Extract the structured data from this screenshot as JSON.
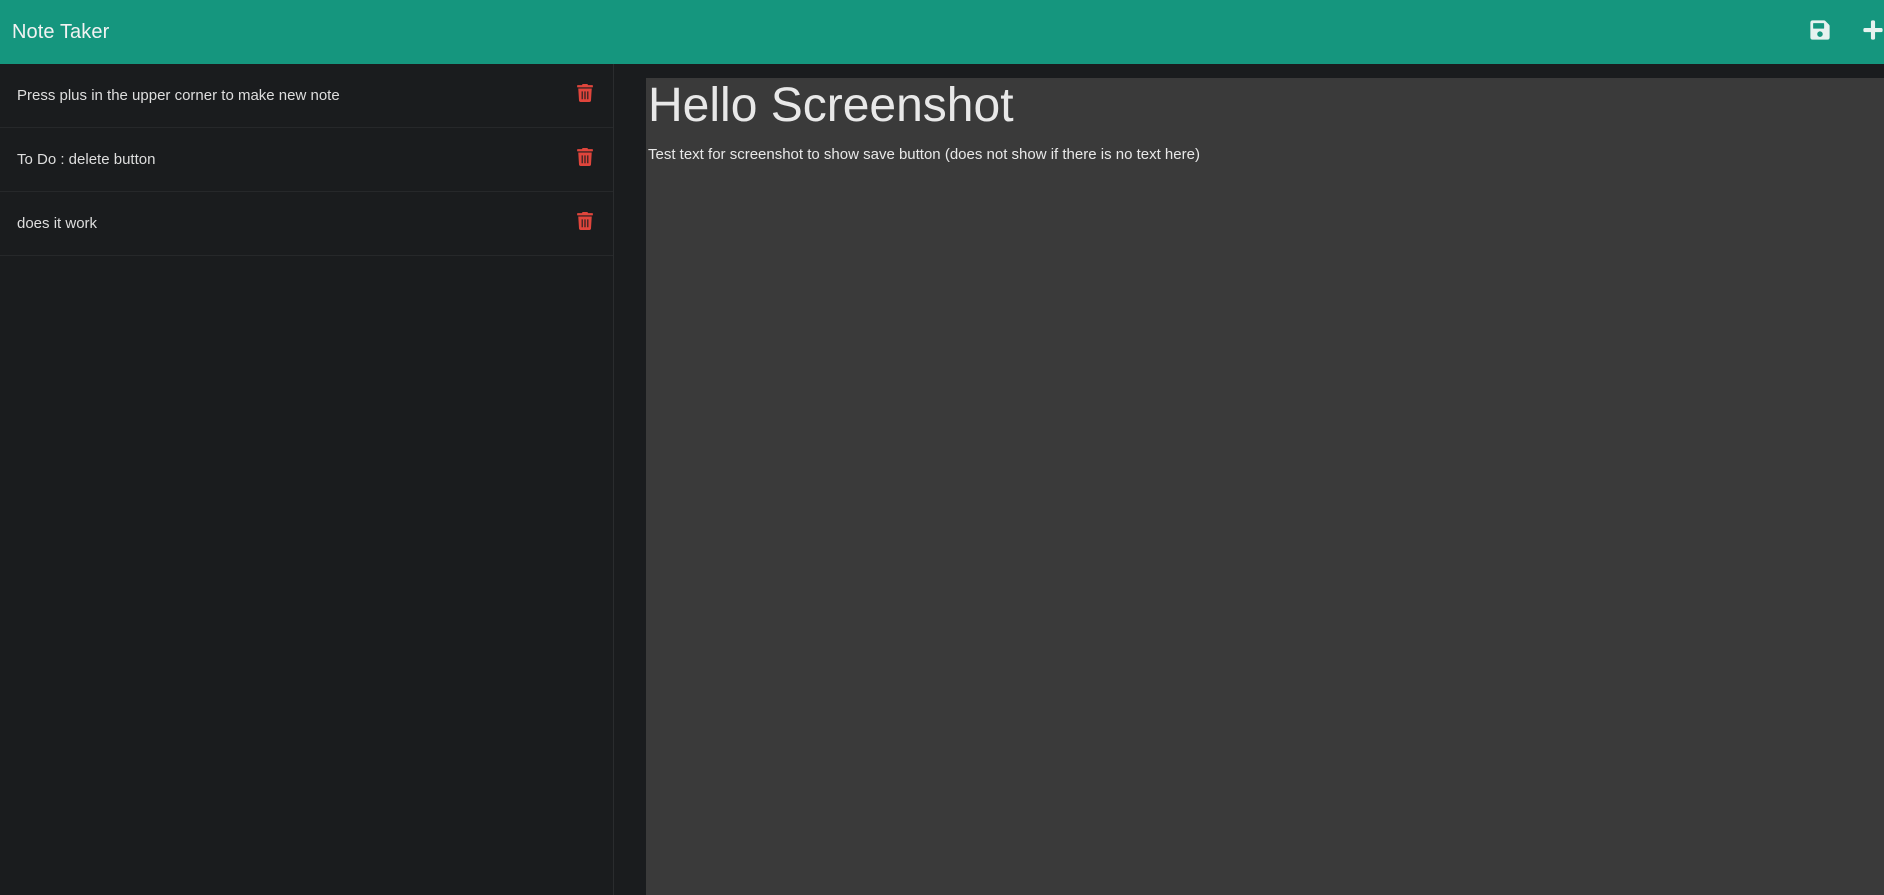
{
  "navbar": {
    "brand": "Note Taker",
    "save_icon": "floppy-disk-icon",
    "new_icon": "plus-icon",
    "accent": "#15967e"
  },
  "sidebar": {
    "notes": [
      {
        "title": "Press plus in the upper corner to make new note",
        "icon": "trash-icon"
      },
      {
        "title": "To Do : delete button",
        "icon": "trash-icon"
      },
      {
        "title": "does it work",
        "icon": "trash-icon"
      }
    ],
    "delete_color": "#e0453c"
  },
  "editor": {
    "title": "Hello Screenshot",
    "text": "Test text for screenshot to show save button (does not show if there is no text here)"
  }
}
